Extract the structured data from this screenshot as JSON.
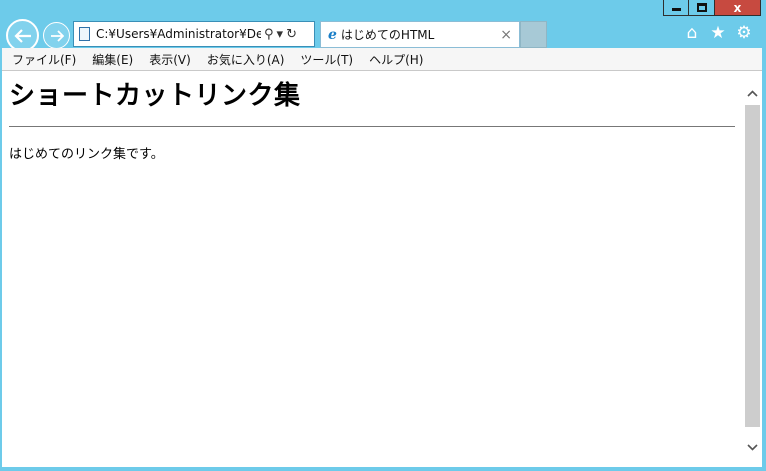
{
  "window": {
    "minimize_glyph": "",
    "close_glyph": "x"
  },
  "navigation": {
    "address": "C:¥Users¥Administrator¥De",
    "search_glyph": "⚲",
    "dropdown_glyph": "▾",
    "refresh_glyph": "↻",
    "back_glyph": "←",
    "forward_glyph": "→"
  },
  "tabs": [
    {
      "title": "はじめてのHTML",
      "icon": "ie-icon",
      "close": "×"
    }
  ],
  "toolbar_icons": {
    "home": "⌂",
    "favorites": "★",
    "settings": "⚙"
  },
  "menu": [
    "ファイル(F)",
    "編集(E)",
    "表示(V)",
    "お気に入り(A)",
    "ツール(T)",
    "ヘルプ(H)"
  ],
  "page": {
    "heading": "ショートカットリンク集",
    "paragraph": "はじめてのリンク集です。"
  },
  "scrollbar": {
    "up_glyph": "⌃",
    "down_glyph": "⌄"
  },
  "colors": {
    "frame": "#6dcbea",
    "close_button": "#c74a40",
    "menubar": "#f6f6f6"
  }
}
